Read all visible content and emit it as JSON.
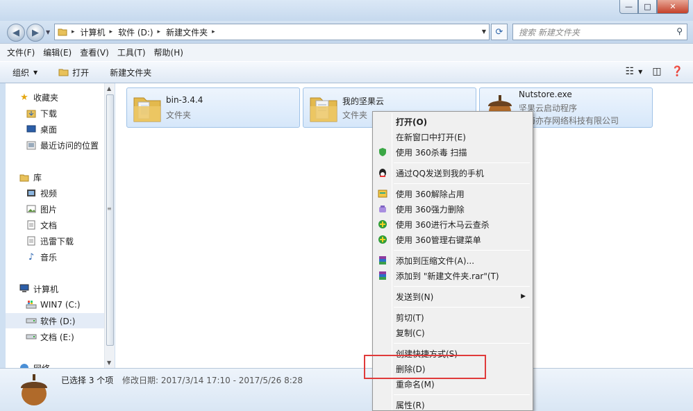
{
  "window": {
    "min_glyph": "—",
    "max_glyph": "□",
    "close_glyph": "✕"
  },
  "address": {
    "crumbs": [
      "计算机",
      "软件 (D:)",
      "新建文件夹"
    ],
    "separator": "▸",
    "search_placeholder": "搜索 新建文件夹"
  },
  "menubar": {
    "items": [
      "文件(F)",
      "编辑(E)",
      "查看(V)",
      "工具(T)",
      "帮助(H)"
    ]
  },
  "toolbar": {
    "organize": "组织",
    "open": "打开",
    "new_folder": "新建文件夹"
  },
  "sidebar": {
    "favorites": {
      "label": "收藏夹",
      "items": [
        "下载",
        "桌面",
        "最近访问的位置"
      ]
    },
    "libraries": {
      "label": "库",
      "items": [
        "视频",
        "图片",
        "文档",
        "迅雷下载",
        "音乐"
      ]
    },
    "computer": {
      "label": "计算机",
      "items": [
        "WIN7 (C:)",
        "软件 (D:)",
        "文档 (E:)"
      ]
    },
    "network": {
      "label": "网络"
    }
  },
  "files": [
    {
      "name": "bin-3.4.4",
      "type": "文件夹"
    },
    {
      "name": "我的坚果云",
      "type": "文件夹"
    },
    {
      "name": "Nutstore.exe",
      "type": "坚果云启动程序",
      "publisher": "上海亦存网络科技有限公司"
    }
  ],
  "status": {
    "selected": "已选择 3 个项",
    "modified": "修改日期: 2017/3/14 17:10 - 2017/5/26 8:28"
  },
  "context_menu": {
    "items": [
      "打开(O)",
      "在新窗口中打开(E)",
      "使用 360杀毒 扫描",
      "通过QQ发送到我的手机",
      "使用 360解除占用",
      "使用 360强力删除",
      "使用 360进行木马云查杀",
      "使用 360管理右键菜单",
      "添加到压缩文件(A)...",
      "添加到 \"新建文件夹.rar\"(T)",
      "发送到(N)",
      "剪切(T)",
      "复制(C)",
      "创建快捷方式(S)",
      "删除(D)",
      "重命名(M)",
      "属性(R)"
    ]
  },
  "colors": {
    "highlight_box": "#e03a3a",
    "tile_border": "#9fc2e7"
  }
}
